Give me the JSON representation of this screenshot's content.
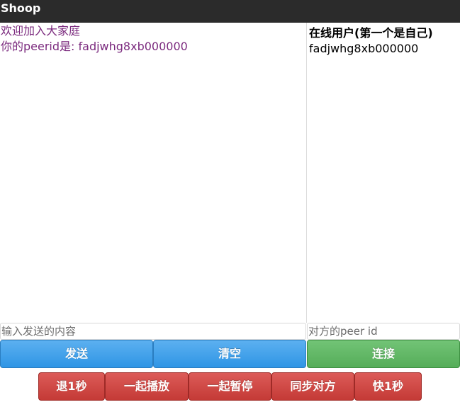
{
  "app": {
    "title": "Shoop"
  },
  "chat": {
    "messages": [
      "欢迎加入大家庭",
      "你的peerid是: fadjwhg8xb000000"
    ]
  },
  "users": {
    "heading": "在线用户(第一个是自己)",
    "list": [
      "fadjwhg8xb000000"
    ]
  },
  "inputs": {
    "message_placeholder": "输入发送的内容",
    "peer_placeholder": "对方的peer id"
  },
  "buttons": {
    "send": "发送",
    "clear": "清空",
    "connect": "连接",
    "back_1s": "退1秒",
    "play_together": "一起播放",
    "pause_together": "一起暂停",
    "sync_peer": "同步对方",
    "forward_1s": "快1秒"
  },
  "colors": {
    "titlebar": "#2b2b2b",
    "chat_text": "#7b2a7e",
    "blue_button": "#3a9be8",
    "green_button": "#5cb85c",
    "red_button": "#d9534f"
  }
}
